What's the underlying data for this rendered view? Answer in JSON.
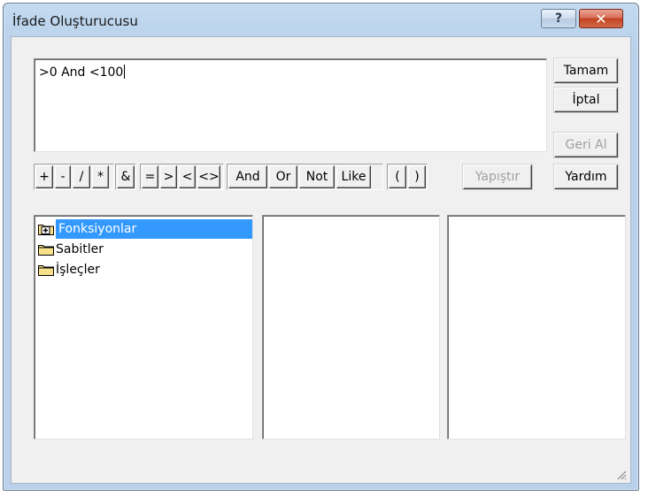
{
  "window": {
    "title": "İfade Oluşturucusu",
    "help_glyph": "?",
    "close_glyph": "✕"
  },
  "expression": {
    "value": ">0 And <100"
  },
  "side_buttons": {
    "ok": "Tamam",
    "cancel": "İptal",
    "undo": "Geri Al",
    "paste": "Yapıştır",
    "help": "Yardım"
  },
  "operators": {
    "arith": [
      "+",
      "-",
      "/",
      "*"
    ],
    "concat": [
      "&"
    ],
    "compare": [
      "=",
      ">",
      "<",
      "<>"
    ],
    "logical": [
      "And",
      "Or",
      "Not",
      "Like"
    ],
    "paren": [
      "(",
      ")"
    ]
  },
  "tree": {
    "items": [
      {
        "label": "Fonksiyonlar",
        "icon": "folder-plus-icon",
        "selected": true
      },
      {
        "label": "Sabitler",
        "icon": "folder-icon",
        "selected": false
      },
      {
        "label": "İşleçler",
        "icon": "folder-icon",
        "selected": false
      }
    ]
  },
  "colors": {
    "selection": "#3399ff",
    "folder": "#f7e08a",
    "close": "#c2411f"
  }
}
